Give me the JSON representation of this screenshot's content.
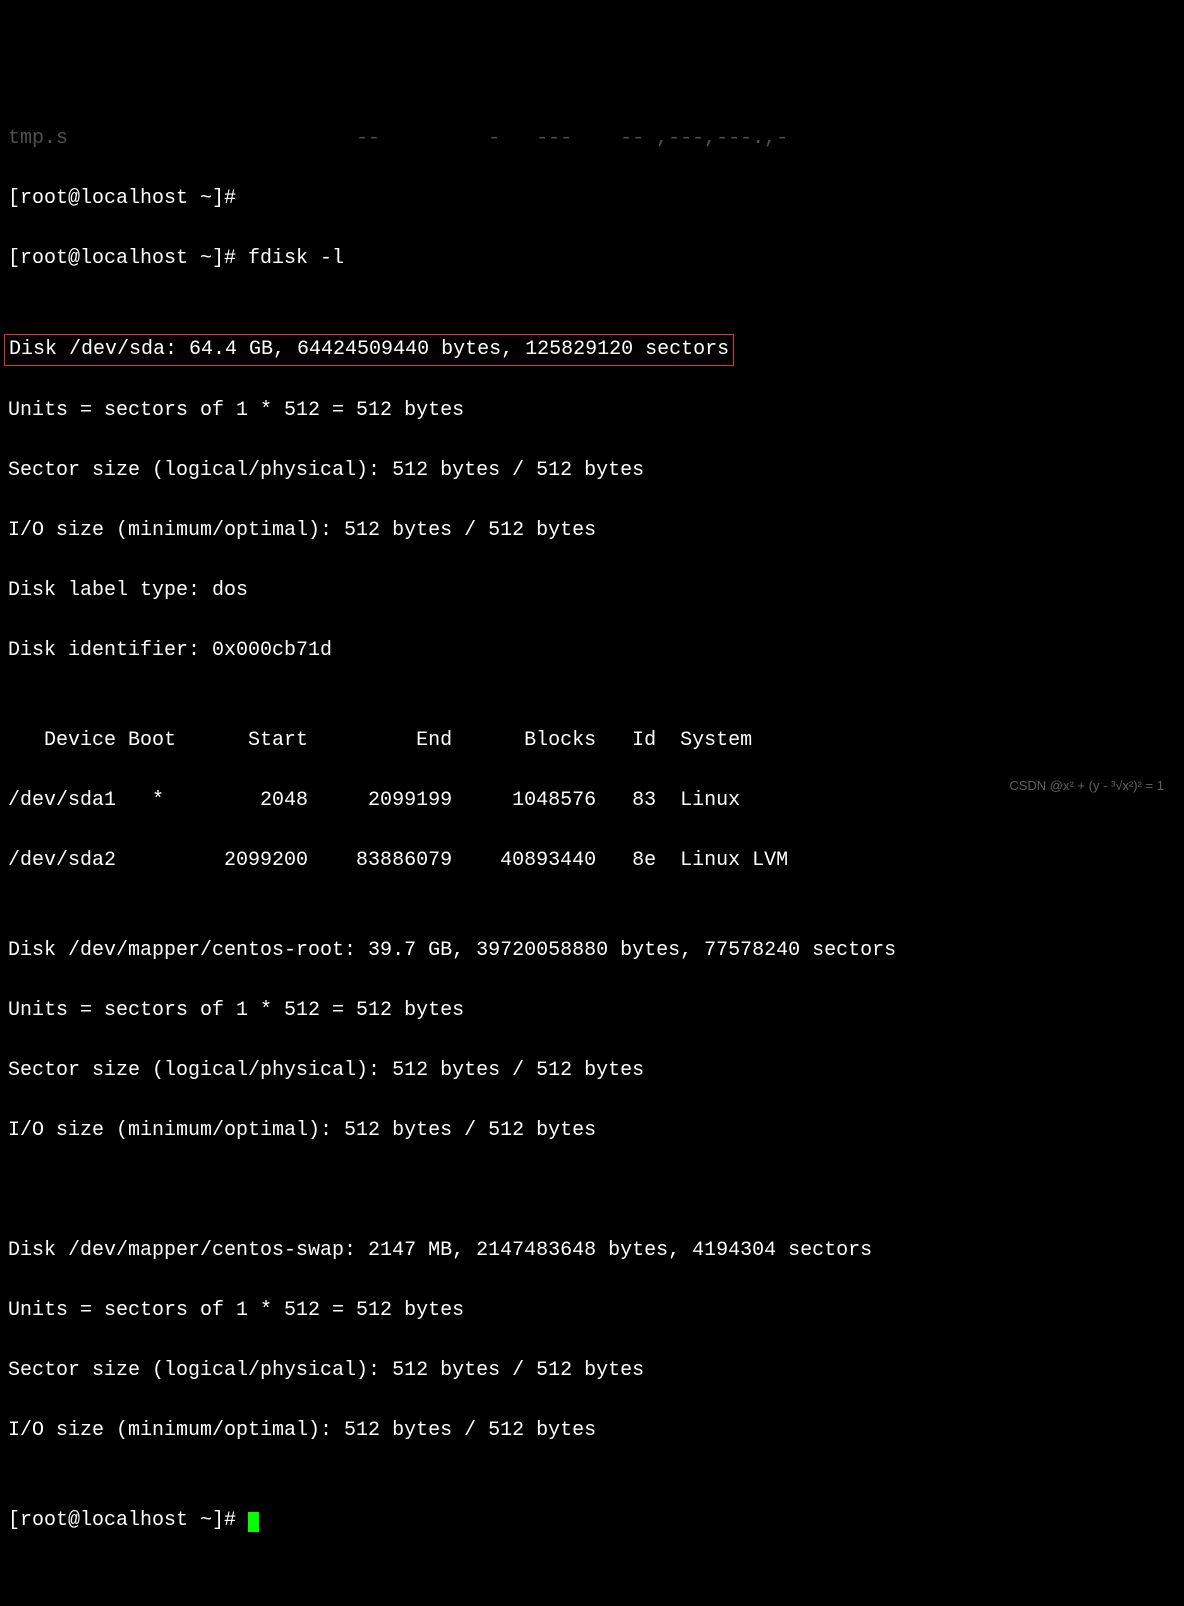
{
  "lines": {
    "l0": "tmp.s                        --         -   ---    -- ,---,---.,-",
    "l1": "[root@localhost ~]#",
    "l2": "[root@localhost ~]# fdisk -l",
    "l3": "",
    "l4": "Disk /dev/sda: 64.4 GB, 64424509440 bytes, 125829120 sectors",
    "l5": "Units = sectors of 1 * 512 = 512 bytes",
    "l6": "Sector size (logical/physical): 512 bytes / 512 bytes",
    "l7": "I/O size (minimum/optimal): 512 bytes / 512 bytes",
    "l8": "Disk label type: dos",
    "l9": "Disk identifier: 0x000cb71d",
    "l10": "",
    "l11": "   Device Boot      Start         End      Blocks   Id  System",
    "l12": "/dev/sda1   *        2048     2099199     1048576   83  Linux",
    "l13": "/dev/sda2         2099200    83886079    40893440   8e  Linux LVM",
    "l14": "",
    "l15": "Disk /dev/mapper/centos-root: 39.7 GB, 39720058880 bytes, 77578240 sectors",
    "l16": "Units = sectors of 1 * 512 = 512 bytes",
    "l17": "Sector size (logical/physical): 512 bytes / 512 bytes",
    "l18": "I/O size (minimum/optimal): 512 bytes / 512 bytes",
    "l19": "",
    "l20": "",
    "l21": "Disk /dev/mapper/centos-swap: 2147 MB, 2147483648 bytes, 4194304 sectors",
    "l22": "Units = sectors of 1 * 512 = 512 bytes",
    "l23": "Sector size (logical/physical): 512 bytes / 512 bytes",
    "l24": "I/O size (minimum/optimal): 512 bytes / 512 bytes",
    "l25": "",
    "l26": "[root@localhost ~]# "
  },
  "watermark": "CSDN @x² + (y - ³√x²)² = 1"
}
